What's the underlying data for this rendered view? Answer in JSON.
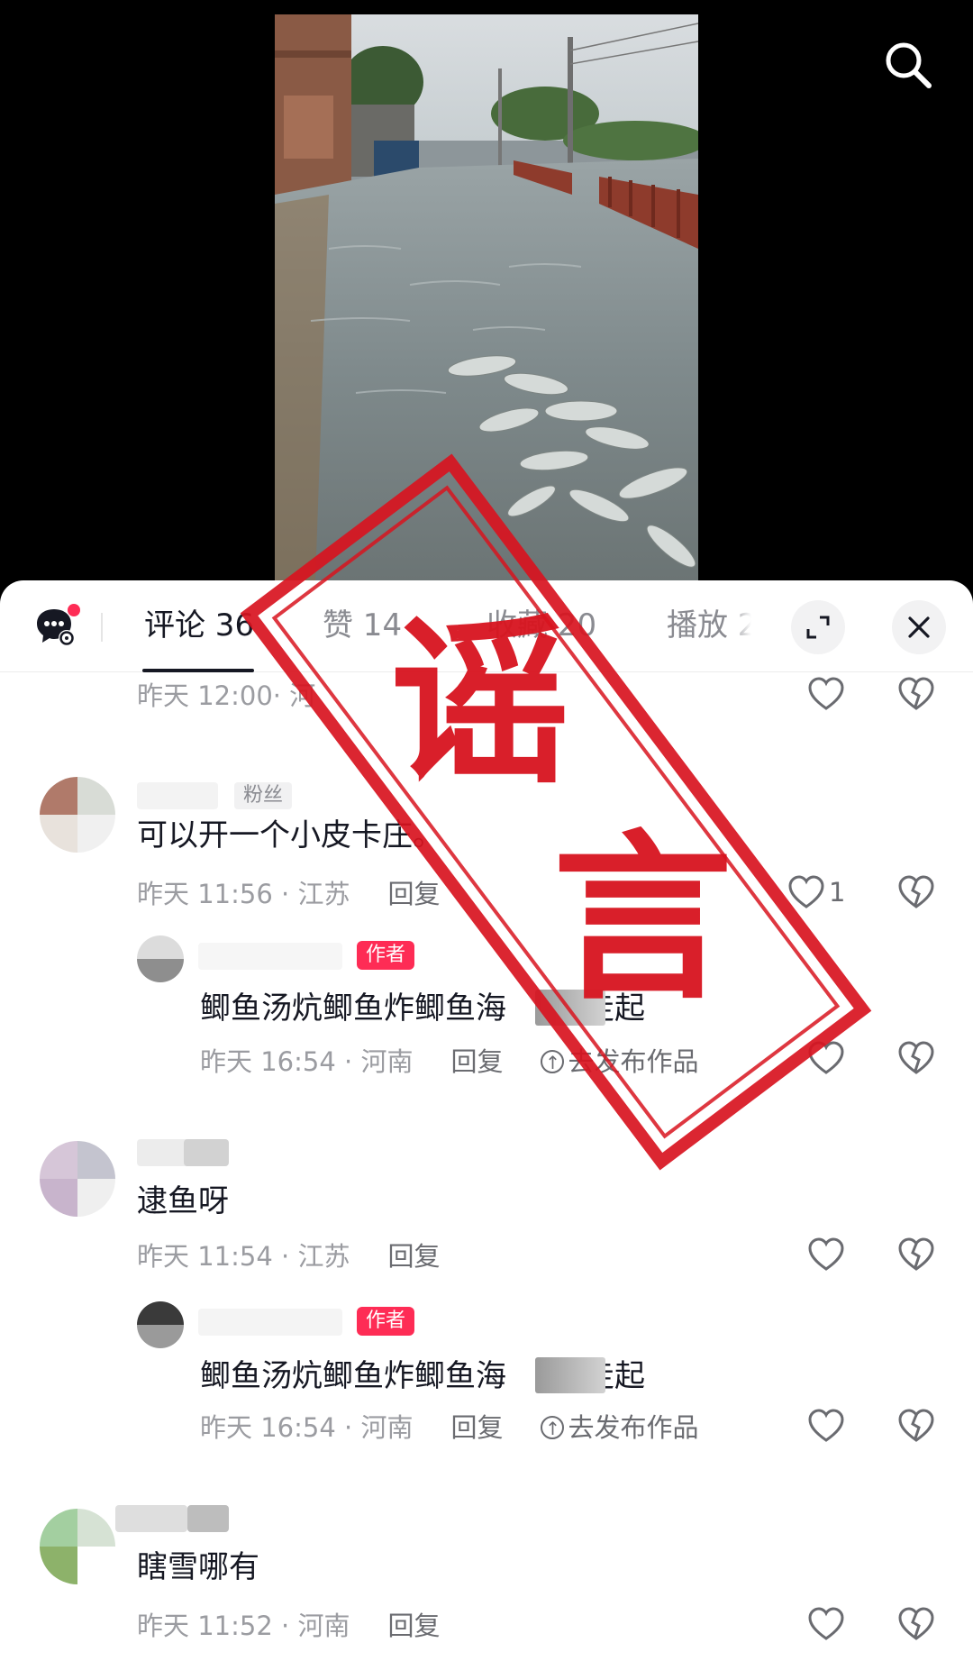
{
  "tabs": {
    "comments": "评论 36",
    "likes": "赞 14",
    "favorites": "收藏 20",
    "plays": "播放 2"
  },
  "comments": [
    {
      "meta_time": "昨天 12:00",
      "meta_loc": "· 河"
    },
    {
      "fan_badge": "粉丝",
      "text": "可以开一个小皮卡庄。",
      "time": "昨天 11:56 · 江苏",
      "reply": "回复",
      "like_count": "1",
      "reply_item": {
        "author_badge": "作者",
        "text_a": "鲫鱼汤炕鲫鱼炸鲫鱼海",
        "text_b": "走起",
        "time": "昨天 16:54 · 河南",
        "reply": "回复",
        "publish": "去发布作品"
      }
    },
    {
      "text": "逮鱼呀",
      "time": "昨天 11:54 · 江苏",
      "reply": "回复",
      "reply_item": {
        "author_badge": "作者",
        "text_a": "鲫鱼汤炕鲫鱼炸鲫鱼海",
        "text_b": "走起",
        "time": "昨天 16:54 · 河南",
        "reply": "回复",
        "publish": "去发布作品"
      }
    },
    {
      "text": "瞎雪哪有",
      "time": "昨天 11:52 · 河南",
      "reply": "回复"
    }
  ],
  "stamp": {
    "char_top": "谣",
    "char_bottom": "言"
  },
  "colors": {
    "stamp_red": "#d8141f",
    "author_badge": "#fe2c55",
    "notification_dot": "#fe2c55"
  }
}
